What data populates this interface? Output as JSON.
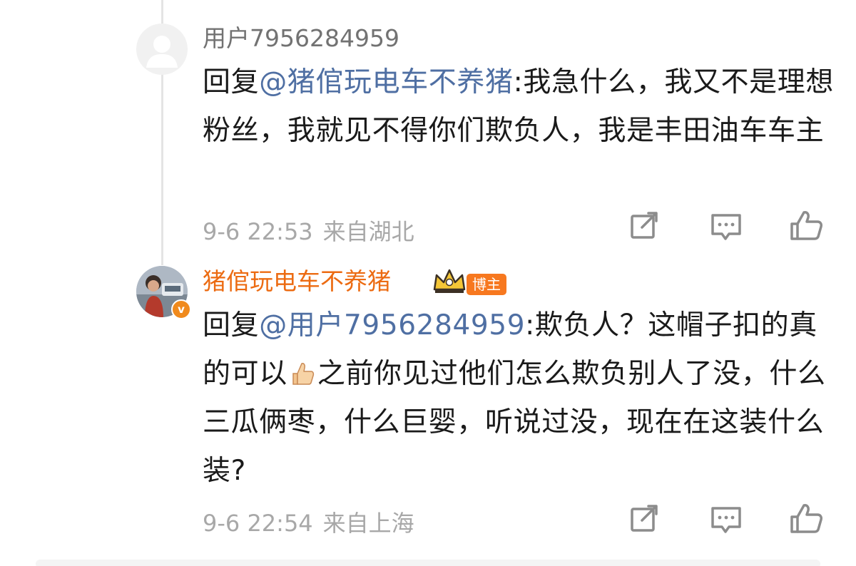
{
  "comments": [
    {
      "username": "用户7956284959",
      "reply_prefix": "回复",
      "mention": "@猪倌玩电车不养猪",
      "text_before_emoji": ":我急什么，我又不是理想粉丝，我就见不得你们欺负人，我是丰田油车车主",
      "text_after_emoji": "",
      "time": "9-6 22:53",
      "location": "来自湖北",
      "actions": [
        "share-icon",
        "comment-icon",
        "like-icon"
      ]
    },
    {
      "username": "猪倌玩电车不养猪",
      "role_badge": "博主",
      "verified": "v",
      "reply_prefix": "回复",
      "mention": "@用户7956284959",
      "text_before_emoji": ":欺负人？这帽子扣的真的可以",
      "emoji": "thumbs-up-emoji",
      "text_after_emoji": "之前你见过他们怎么欺负别人了没，什么三瓜俩枣，什么巨婴，听说过没，现在在这装什么装?",
      "time": "9-6 22:54",
      "location": "来自上海",
      "actions": [
        "share-icon",
        "comment-icon",
        "like-icon"
      ]
    }
  ],
  "colors": {
    "mention": "#4f6fa3",
    "author_name": "#ec6b12",
    "user_name": "#727272",
    "meta": "#a8a8a8",
    "badge": "#f7781f"
  }
}
